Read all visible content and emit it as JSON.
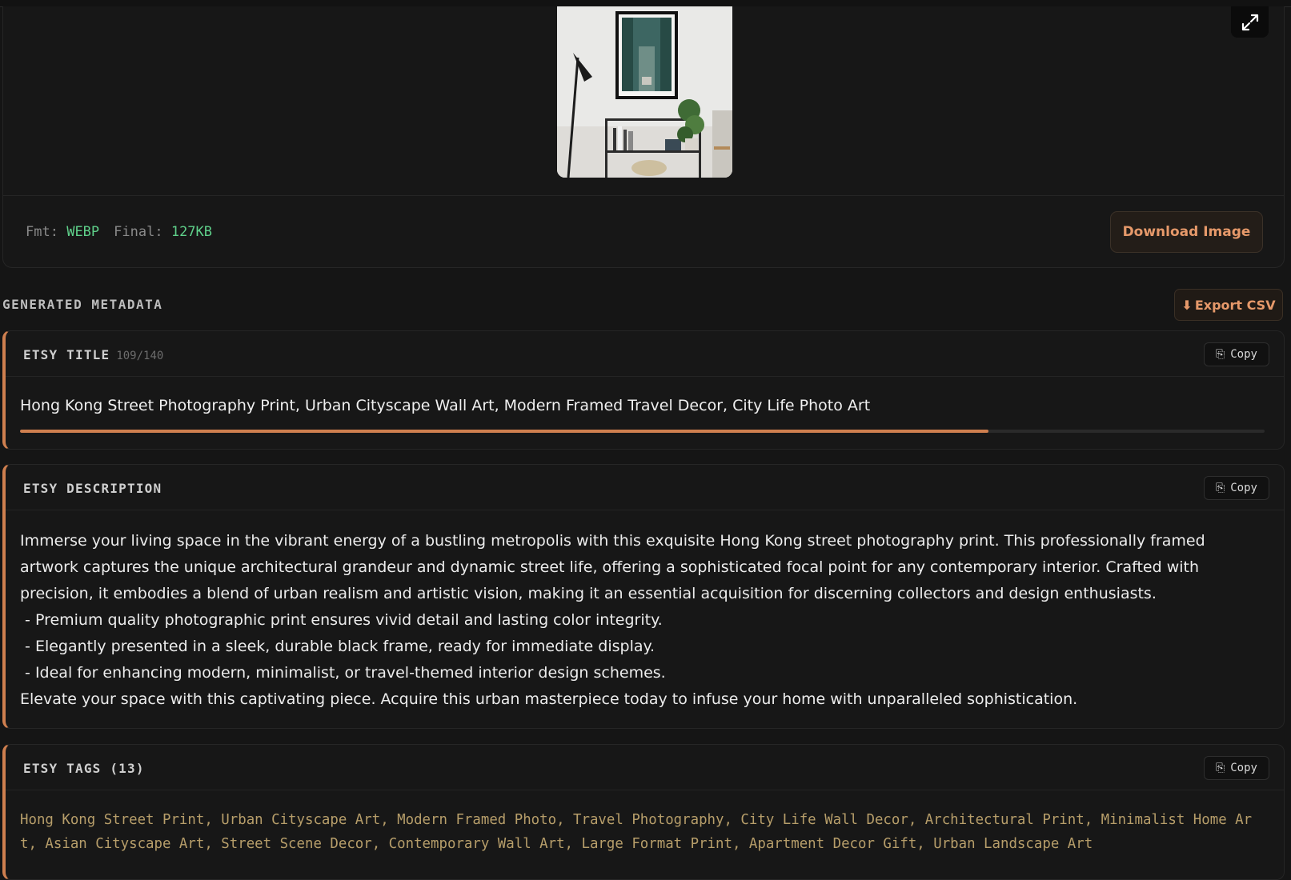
{
  "image_panel": {
    "expand_icon": "expand-icon",
    "format_label": "Fmt:",
    "format_value": "WEBP",
    "final_label": "Final:",
    "final_value": "127KB",
    "download_label": "Download Image"
  },
  "metadata": {
    "heading": "GENERATED METADATA",
    "export_label": "Export CSV",
    "export_icon": "download-arrow-icon"
  },
  "title_card": {
    "heading": "ETSY TITLE",
    "count": "109/140",
    "copy_label": "Copy",
    "text": "Hong Kong Street Photography Print, Urban Cityscape Wall Art, Modern Framed Travel Decor, City Life Photo Art",
    "progress": 0.778
  },
  "description_card": {
    "heading": "ETSY DESCRIPTION",
    "copy_label": "Copy",
    "lines": [
      "Immerse your living space in the vibrant energy of a bustling metropolis with this exquisite Hong Kong street photography print. This professionally framed artwork captures the unique architectural grandeur and dynamic street life, offering a sophisticated focal point for any contemporary interior. Crafted with precision, it embodies a blend of urban realism and artistic vision, making it an essential acquisition for discerning collectors and design enthusiasts.",
      " - Premium quality photographic print ensures vivid detail and lasting color integrity.",
      " - Elegantly presented in a sleek, durable black frame, ready for immediate display.",
      " - Ideal for enhancing modern, minimalist, or travel-themed interior design schemes.",
      "Elevate your space with this captivating piece. Acquire this urban masterpiece today to infuse your home with unparalleled sophistication."
    ]
  },
  "tags_card": {
    "heading": "ETSY TAGS (13)",
    "copy_label": "Copy",
    "text": "Hong Kong Street Print, Urban Cityscape Art, Modern Framed Photo, Travel Photography, City Life Wall Decor, Architectural Print, Minimalist Home Art, Asian Cityscape Art, Street Scene Decor, Contemporary Wall Art, Large Format Print, Apartment Decor Gift, Urban Landscape Art"
  },
  "colors": {
    "accent": "#cf7f4f",
    "value_green": "#5fd08a",
    "tags_text": "#b79e6a"
  }
}
